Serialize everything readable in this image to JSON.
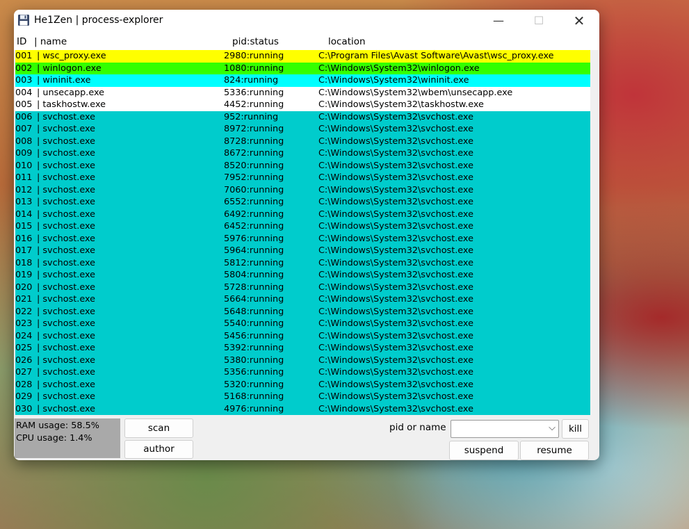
{
  "window": {
    "title": "He1Zen | process-explorer",
    "controls": {
      "minimize": "—",
      "maximize": "☐",
      "close": "✕"
    }
  },
  "columns": {
    "id": "ID",
    "name": "| name",
    "pid_status": "pid:status",
    "location": "location"
  },
  "colors": {
    "yellow": "#ffff00",
    "green": "#33ff00",
    "cyan": "#00ffff",
    "white": "#ffffff",
    "teal": "#00cccc",
    "ram_panel": "#a9a9a9"
  },
  "processes": [
    {
      "id": "001",
      "name": "| wsc_proxy.exe",
      "pid_status": "2980:running",
      "location": "C:\\Program Files\\Avast Software\\Avast\\wsc_proxy.exe",
      "color": "yellow"
    },
    {
      "id": "002",
      "name": "| winlogon.exe",
      "pid_status": "1080:running",
      "location": "C:\\Windows\\System32\\winlogon.exe",
      "color": "green"
    },
    {
      "id": "003",
      "name": "| wininit.exe",
      "pid_status": "824:running",
      "location": "C:\\Windows\\System32\\wininit.exe",
      "color": "cyan"
    },
    {
      "id": "004",
      "name": "| unsecapp.exe",
      "pid_status": "5336:running",
      "location": "C:\\Windows\\System32\\wbem\\unsecapp.exe",
      "color": "white"
    },
    {
      "id": "005",
      "name": "| taskhostw.exe",
      "pid_status": "4452:running",
      "location": "C:\\Windows\\System32\\taskhostw.exe",
      "color": "white"
    },
    {
      "id": "006",
      "name": "| svchost.exe",
      "pid_status": "952:running",
      "location": "C:\\Windows\\System32\\svchost.exe",
      "color": "teal"
    },
    {
      "id": "007",
      "name": "| svchost.exe",
      "pid_status": "8972:running",
      "location": "C:\\Windows\\System32\\svchost.exe",
      "color": "teal"
    },
    {
      "id": "008",
      "name": "| svchost.exe",
      "pid_status": "8728:running",
      "location": "C:\\Windows\\System32\\svchost.exe",
      "color": "teal"
    },
    {
      "id": "009",
      "name": "| svchost.exe",
      "pid_status": "8672:running",
      "location": "C:\\Windows\\System32\\svchost.exe",
      "color": "teal"
    },
    {
      "id": "010",
      "name": "| svchost.exe",
      "pid_status": "8520:running",
      "location": "C:\\Windows\\System32\\svchost.exe",
      "color": "teal"
    },
    {
      "id": "011",
      "name": "| svchost.exe",
      "pid_status": "7952:running",
      "location": "C:\\Windows\\System32\\svchost.exe",
      "color": "teal"
    },
    {
      "id": "012",
      "name": "| svchost.exe",
      "pid_status": "7060:running",
      "location": "C:\\Windows\\System32\\svchost.exe",
      "color": "teal"
    },
    {
      "id": "013",
      "name": "| svchost.exe",
      "pid_status": "6552:running",
      "location": "C:\\Windows\\System32\\svchost.exe",
      "color": "teal"
    },
    {
      "id": "014",
      "name": "| svchost.exe",
      "pid_status": "6492:running",
      "location": "C:\\Windows\\System32\\svchost.exe",
      "color": "teal"
    },
    {
      "id": "015",
      "name": "| svchost.exe",
      "pid_status": "6452:running",
      "location": "C:\\Windows\\System32\\svchost.exe",
      "color": "teal"
    },
    {
      "id": "016",
      "name": "| svchost.exe",
      "pid_status": "5976:running",
      "location": "C:\\Windows\\System32\\svchost.exe",
      "color": "teal"
    },
    {
      "id": "017",
      "name": "| svchost.exe",
      "pid_status": "5964:running",
      "location": "C:\\Windows\\System32\\svchost.exe",
      "color": "teal"
    },
    {
      "id": "018",
      "name": "| svchost.exe",
      "pid_status": "5812:running",
      "location": "C:\\Windows\\System32\\svchost.exe",
      "color": "teal"
    },
    {
      "id": "019",
      "name": "| svchost.exe",
      "pid_status": "5804:running",
      "location": "C:\\Windows\\System32\\svchost.exe",
      "color": "teal"
    },
    {
      "id": "020",
      "name": "| svchost.exe",
      "pid_status": "5728:running",
      "location": "C:\\Windows\\System32\\svchost.exe",
      "color": "teal"
    },
    {
      "id": "021",
      "name": "| svchost.exe",
      "pid_status": "5664:running",
      "location": "C:\\Windows\\System32\\svchost.exe",
      "color": "teal"
    },
    {
      "id": "022",
      "name": "| svchost.exe",
      "pid_status": "5648:running",
      "location": "C:\\Windows\\System32\\svchost.exe",
      "color": "teal"
    },
    {
      "id": "023",
      "name": "| svchost.exe",
      "pid_status": "5540:running",
      "location": "C:\\Windows\\System32\\svchost.exe",
      "color": "teal"
    },
    {
      "id": "024",
      "name": "| svchost.exe",
      "pid_status": "5456:running",
      "location": "C:\\Windows\\System32\\svchost.exe",
      "color": "teal"
    },
    {
      "id": "025",
      "name": "| svchost.exe",
      "pid_status": "5392:running",
      "location": "C:\\Windows\\System32\\svchost.exe",
      "color": "teal"
    },
    {
      "id": "026",
      "name": "| svchost.exe",
      "pid_status": "5380:running",
      "location": "C:\\Windows\\System32\\svchost.exe",
      "color": "teal"
    },
    {
      "id": "027",
      "name": "| svchost.exe",
      "pid_status": "5356:running",
      "location": "C:\\Windows\\System32\\svchost.exe",
      "color": "teal"
    },
    {
      "id": "028",
      "name": "| svchost.exe",
      "pid_status": "5320:running",
      "location": "C:\\Windows\\System32\\svchost.exe",
      "color": "teal"
    },
    {
      "id": "029",
      "name": "| svchost.exe",
      "pid_status": "5168:running",
      "location": "C:\\Windows\\System32\\svchost.exe",
      "color": "teal"
    },
    {
      "id": "030",
      "name": "| svchost.exe",
      "pid_status": "4976:running",
      "location": "C:\\Windows\\System32\\svchost.exe",
      "color": "teal"
    }
  ],
  "status": {
    "ram": "RAM usage: 58.5%",
    "cpu": "CPU usage: 1.4%"
  },
  "buttons": {
    "scan": "scan",
    "author": "author",
    "kill": "kill",
    "suspend": "suspend",
    "resume": "resume"
  },
  "target": {
    "label": "pid or name",
    "value": ""
  }
}
